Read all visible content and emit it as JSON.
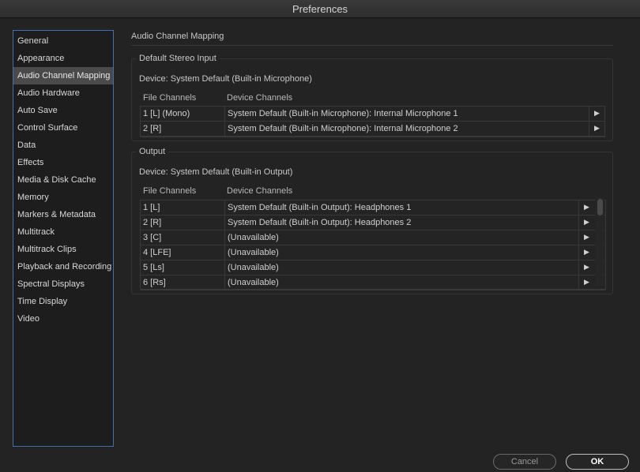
{
  "window": {
    "title": "Preferences"
  },
  "sidebar": {
    "items": [
      {
        "label": "General"
      },
      {
        "label": "Appearance"
      },
      {
        "label": "Audio Channel Mapping",
        "selected": true
      },
      {
        "label": "Audio Hardware"
      },
      {
        "label": "Auto Save"
      },
      {
        "label": "Control Surface"
      },
      {
        "label": "Data"
      },
      {
        "label": "Effects"
      },
      {
        "label": "Media & Disk Cache"
      },
      {
        "label": "Memory"
      },
      {
        "label": "Markers & Metadata"
      },
      {
        "label": "Multitrack"
      },
      {
        "label": "Multitrack Clips"
      },
      {
        "label": "Playback and Recording"
      },
      {
        "label": "Spectral Displays"
      },
      {
        "label": "Time Display"
      },
      {
        "label": "Video"
      }
    ]
  },
  "main": {
    "title": "Audio Channel Mapping",
    "input": {
      "group_label": "Default Stereo Input",
      "device": "Device: System Default (Built-in Microphone)",
      "col_file": "File Channels",
      "col_device": "Device Channels",
      "rows": [
        {
          "file": "1 [L] (Mono)",
          "device": "System Default (Built-in Microphone): Internal Microphone 1"
        },
        {
          "file": "2 [R]",
          "device": "System Default (Built-in Microphone): Internal Microphone 2"
        }
      ]
    },
    "output": {
      "group_label": "Output",
      "device": "Device: System Default (Built-in Output)",
      "col_file": "File Channels",
      "col_device": "Device Channels",
      "rows": [
        {
          "file": "1 [L]",
          "device": "System Default (Built-in Output): Headphones 1"
        },
        {
          "file": "2 [R]",
          "device": "System Default (Built-in Output): Headphones 2"
        },
        {
          "file": "3 [C]",
          "device": "(Unavailable)"
        },
        {
          "file": "4 [LFE]",
          "device": "(Unavailable)"
        },
        {
          "file": "5 [Ls]",
          "device": "(Unavailable)"
        },
        {
          "file": "6 [Rs]",
          "device": "(Unavailable)"
        }
      ]
    }
  },
  "footer": {
    "cancel_label": "Cancel",
    "ok_label": "OK"
  },
  "icons": {
    "row_menu": "triangle-right-icon"
  },
  "colors": {
    "background": "#232323",
    "selection": "#4a4a4a",
    "focus_border": "#3e6fb3"
  }
}
